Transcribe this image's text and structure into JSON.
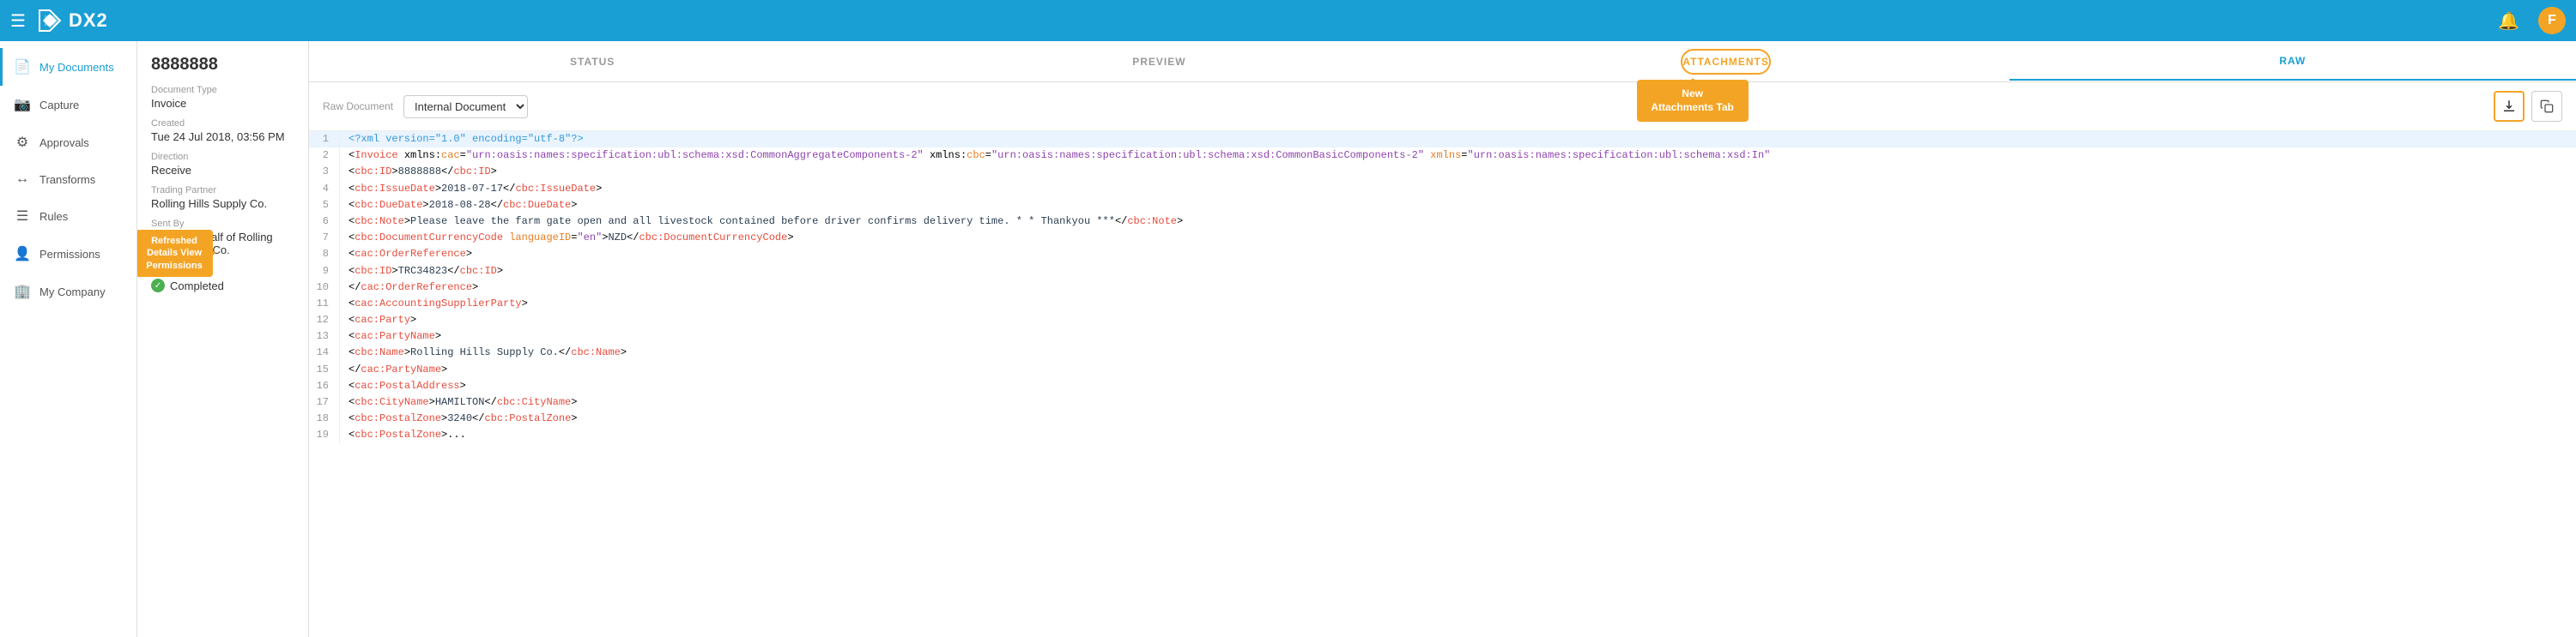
{
  "nav": {
    "hamburger": "☰",
    "logo_text": "DX2",
    "bell": "🔔",
    "avatar": "F"
  },
  "sidebar": {
    "items": [
      {
        "id": "my-documents",
        "label": "My Documents",
        "icon": "📄",
        "active": true
      },
      {
        "id": "capture",
        "label": "Capture",
        "icon": "📷",
        "active": false
      },
      {
        "id": "approvals",
        "label": "Approvals",
        "icon": "⚙",
        "active": false
      },
      {
        "id": "transforms",
        "label": "Transforms",
        "icon": "↔",
        "active": false
      },
      {
        "id": "rules",
        "label": "Rules",
        "icon": "☰",
        "active": false
      },
      {
        "id": "permissions",
        "label": "Permissions",
        "icon": "👤",
        "active": false
      },
      {
        "id": "my-company",
        "label": "My Company",
        "icon": "🏢",
        "active": false
      }
    ]
  },
  "details": {
    "doc_number": "8888888",
    "fields": [
      {
        "label": "Document Type",
        "value": "Invoice"
      },
      {
        "label": "Created",
        "value": "Tue 24 Jul 2018, 03:56 PM"
      },
      {
        "label": "Direction",
        "value": "Receive"
      },
      {
        "label": "Trading Partner",
        "value": "Rolling Hills Supply Co."
      },
      {
        "label": "Sent By",
        "value": "Sent on behalf of Rolling Hills Supply Co."
      },
      {
        "label": "Status",
        "value": "Completed"
      }
    ],
    "annotation": {
      "title": "Refreshed Details View",
      "subtitle": "Permissions"
    }
  },
  "tabs": [
    {
      "id": "status",
      "label": "STATUS",
      "active": false
    },
    {
      "id": "preview",
      "label": "PREVIEW",
      "active": false
    },
    {
      "id": "attachments",
      "label": "ATTACHMENTS",
      "active": false,
      "highlighted": true
    },
    {
      "id": "raw",
      "label": "RAW",
      "active": true
    }
  ],
  "annotations": {
    "new_attachments_tab": "New\nAttachments Tab",
    "download_button": "Download\nButton"
  },
  "raw_toolbar": {
    "label": "Raw Document",
    "select_value": "Internal Document",
    "select_placeholder": "Internal Document"
  },
  "code_lines": [
    {
      "num": 1,
      "content": "<?xml version=\"1.0\" encoding=\"utf-8\"?>",
      "highlighted": true
    },
    {
      "num": 2,
      "content": "<Invoice xmlns:cac=\"urn:oasis:names:specification:ubl:schema:xsd:CommonAggregateComponents-2\" xmlns:cbc=\"urn:oasis:names:specification:ubl:schema:xsd:CommonBasicComponents-2\" xmlns=\"urn:oasis:names:specification:ubl:schema:xsd:In\""
    },
    {
      "num": 3,
      "content": "    <cbc:ID>8888888</cbc:ID>"
    },
    {
      "num": 4,
      "content": "    <cbc:IssueDate>2018-07-17</cbc:IssueDate>"
    },
    {
      "num": 5,
      "content": "    <cbc:DueDate>2018-08-28</cbc:DueDate>"
    },
    {
      "num": 6,
      "content": "    <cbc:Note>Please leave the farm gate open and all livestock contained before driver confirms delivery time. * * Thankyou ***</cbc:Note>"
    },
    {
      "num": 7,
      "content": "    <cbc:DocumentCurrencyCode languageID=\"en\">NZD</cbc:DocumentCurrencyCode>"
    },
    {
      "num": 8,
      "content": "    <cac:OrderReference>"
    },
    {
      "num": 9,
      "content": "        <cbc:ID>TRC34823</cbc:ID>"
    },
    {
      "num": 10,
      "content": "    </cac:OrderReference>"
    },
    {
      "num": 11,
      "content": "    <cac:AccountingSupplierParty>"
    },
    {
      "num": 12,
      "content": "        <cac:Party>"
    },
    {
      "num": 13,
      "content": "            <cac:PartyName>"
    },
    {
      "num": 14,
      "content": "                <cbc:Name>Rolling Hills Supply Co.</cbc:Name>"
    },
    {
      "num": 15,
      "content": "            </cac:PartyName>"
    },
    {
      "num": 16,
      "content": "            <cac:PostalAddress>"
    },
    {
      "num": 17,
      "content": "                <cbc:CityName>HAMILTON</cbc:CityName>"
    },
    {
      "num": 18,
      "content": "                <cbc:PostalZone>3240</cbc:PostalZone>"
    },
    {
      "num": 19,
      "content": "                <cbc:PostalZone>..."
    }
  ]
}
